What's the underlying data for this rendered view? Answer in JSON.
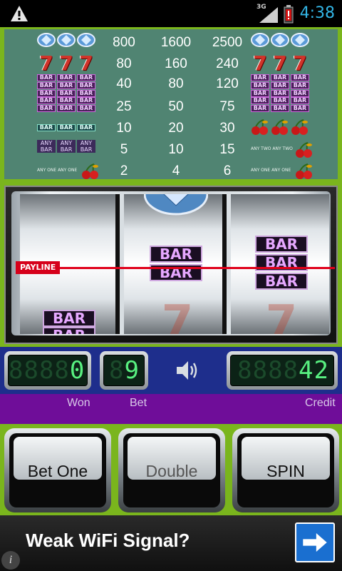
{
  "status_bar": {
    "time": "4:38",
    "network": "3G",
    "icons": [
      "warning-icon",
      "signal-icon",
      "battery-low-icon"
    ]
  },
  "paytable": {
    "rows": [
      {
        "symbol": "diamond",
        "pays": [
          "800",
          "1600",
          "2500"
        ]
      },
      {
        "symbol": "seven",
        "pays": [
          "80",
          "160",
          "240"
        ]
      },
      {
        "symbol": "triple-bar",
        "bar_text": "BAR",
        "pays": [
          "40",
          "80",
          "120"
        ]
      },
      {
        "symbol": "double-bar",
        "bar_text": "BAR",
        "pays": [
          "25",
          "50",
          "75"
        ]
      },
      {
        "symbol": "single-bar",
        "bar_text": "BAR",
        "right_symbol": "cherry",
        "pays": [
          "10",
          "20",
          "30"
        ]
      },
      {
        "symbol": "any-bar",
        "any_text": "ANY",
        "bar_text": "BAR",
        "right_note": "ANY TWO ANY TWO",
        "pays": [
          "5",
          "10",
          "15"
        ]
      },
      {
        "symbol": "any-one",
        "note": "ANY ONE ANY ONE",
        "right_note": "ANY ONE ANY ONE",
        "pays": [
          "2",
          "4",
          "6"
        ]
      }
    ]
  },
  "reels": {
    "payline_label": "PAYLINE",
    "bar_text": "BAR"
  },
  "counters": {
    "won": {
      "ghost": "8888",
      "value": "0",
      "label": "Won"
    },
    "bet": {
      "ghost": "8",
      "value": "9",
      "label": "Bet"
    },
    "credit": {
      "ghost": "8888",
      "value": "42",
      "label": "Credit"
    }
  },
  "buttons": {
    "bet_one": "Bet One",
    "double": "Double",
    "spin": "SPIN"
  },
  "ad": {
    "text": "Weak WiFi Signal?",
    "info": "i"
  },
  "colors": {
    "frame_green": "#7ab51d",
    "paytable_bg": "#508472",
    "counter_blue": "#1e2e8c",
    "label_purple": "#6f0d99",
    "lcd_green": "#58f080",
    "payline_red": "#e0001a"
  }
}
